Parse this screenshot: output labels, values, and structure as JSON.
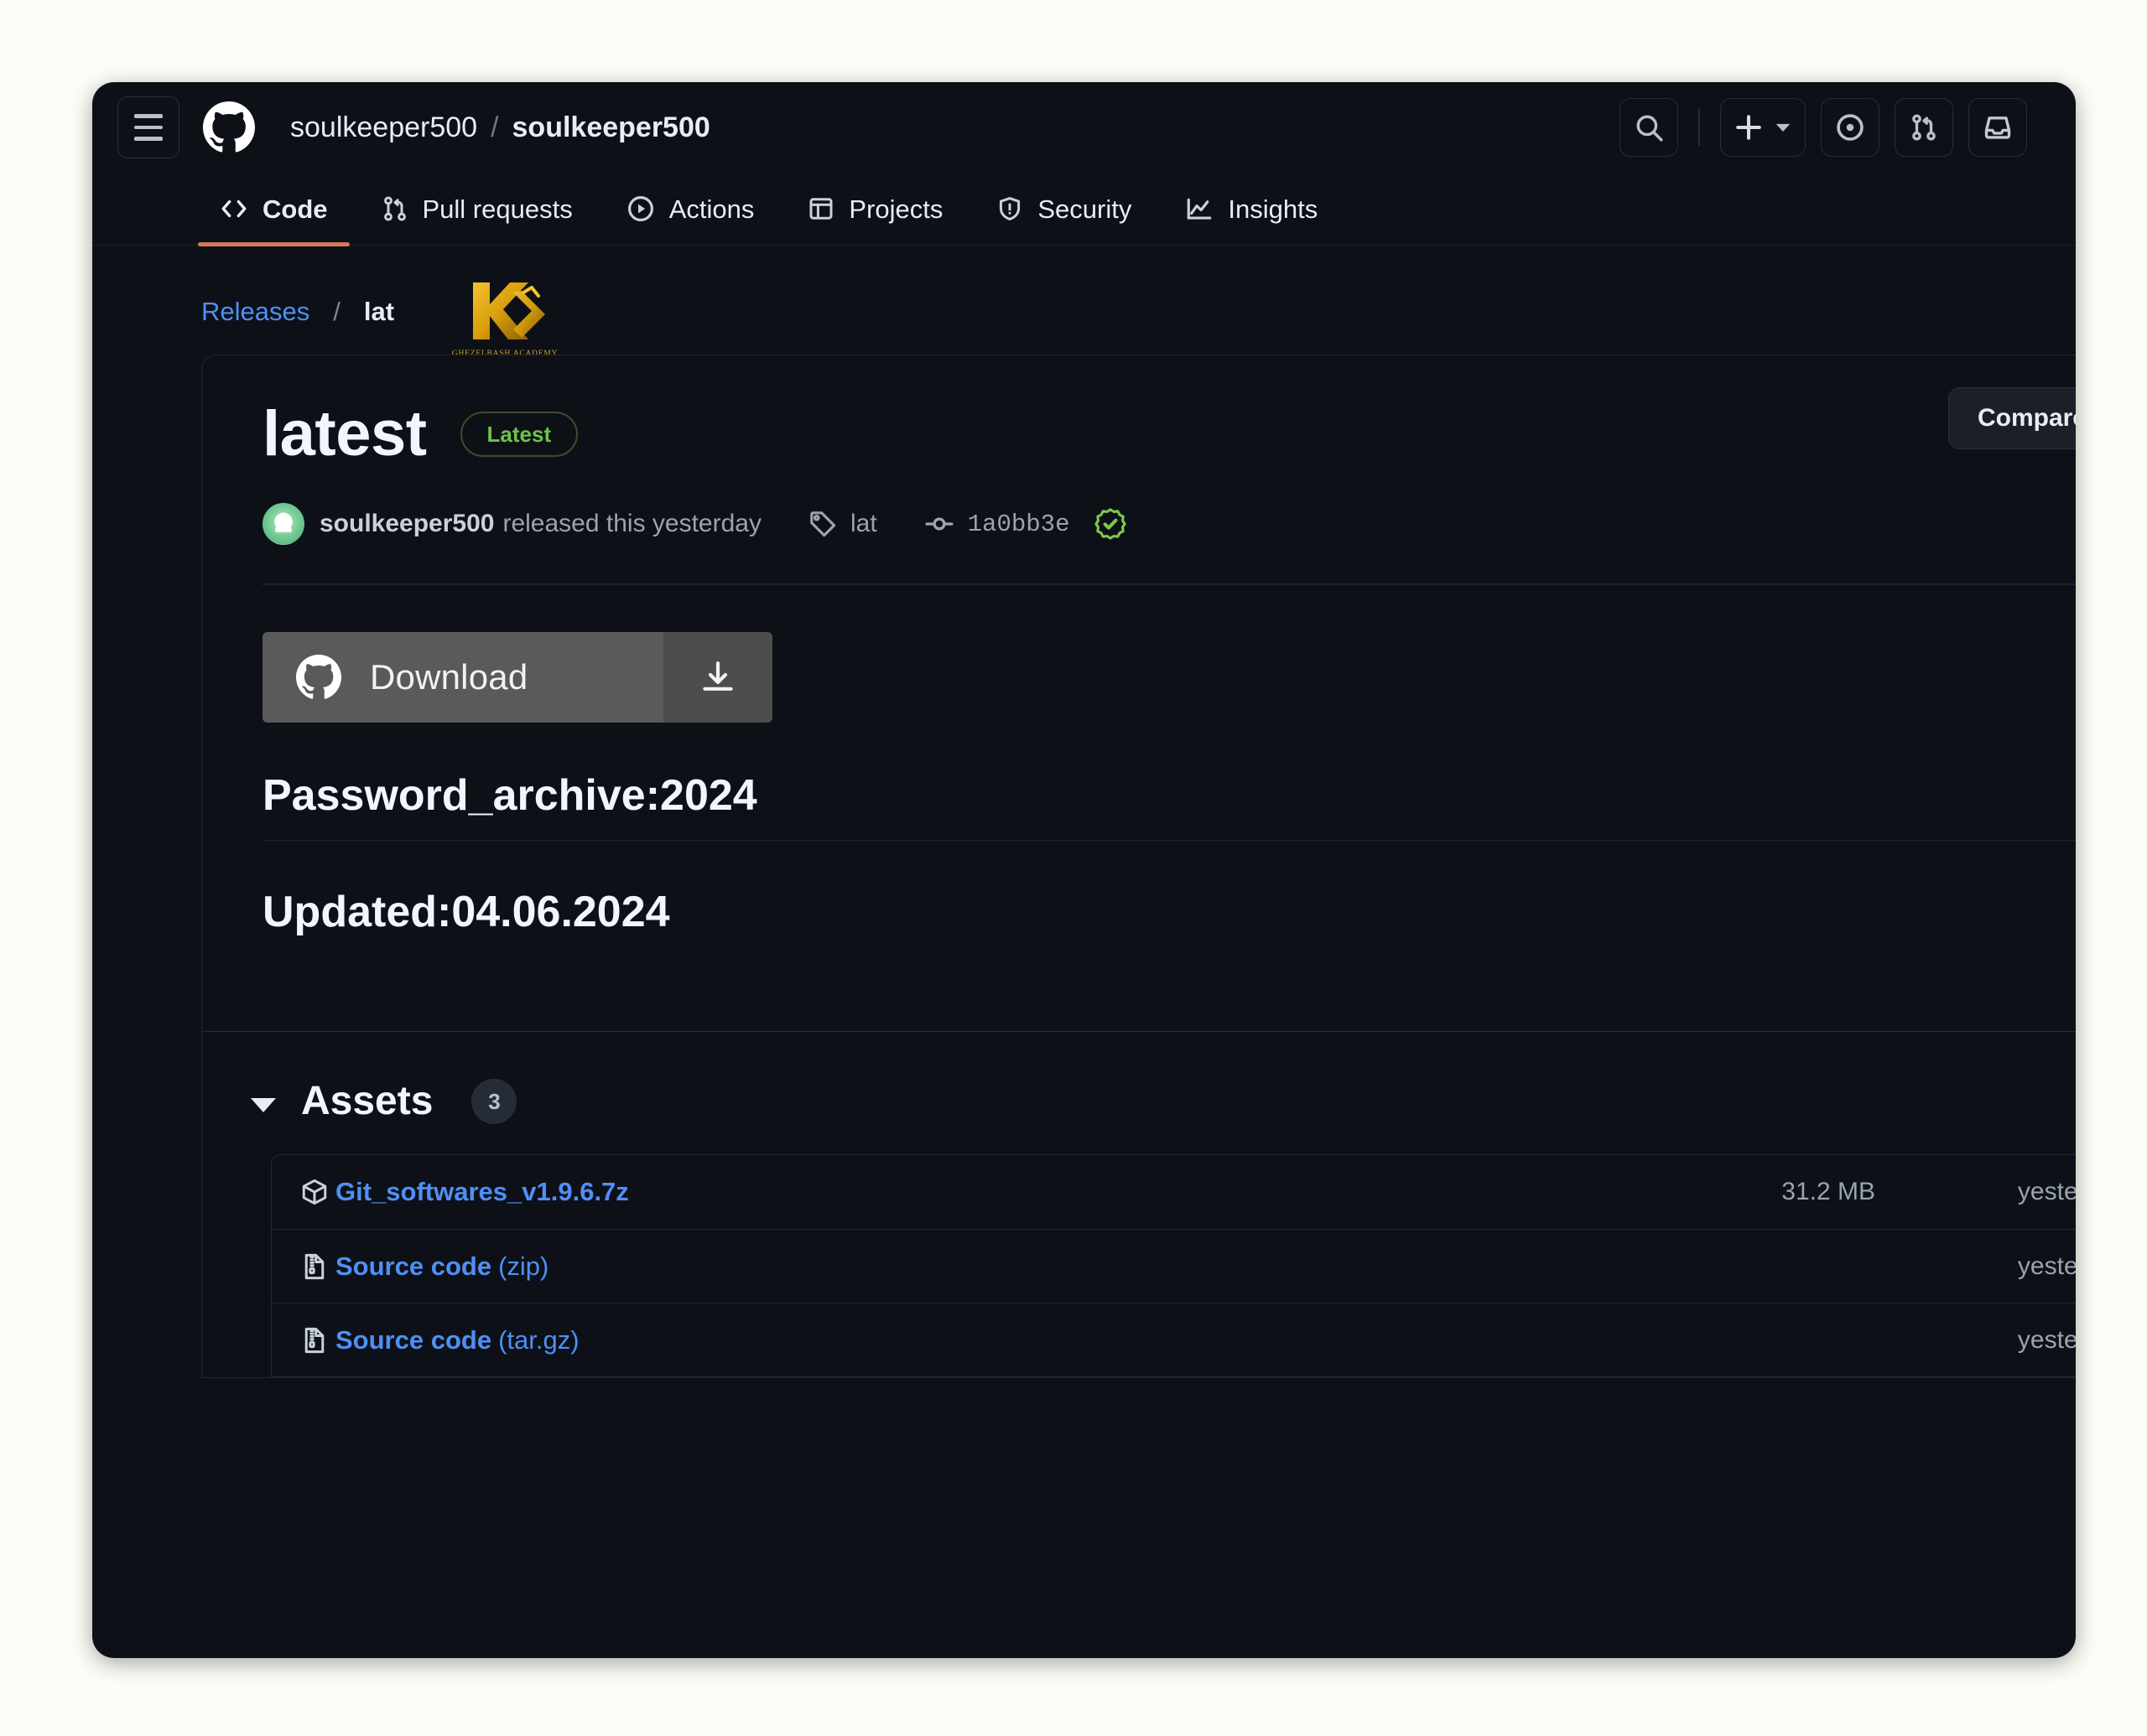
{
  "colors": {
    "page_background": "#fdfdf7",
    "window_background": "#0d1117",
    "accent_link": "#4f8ff7",
    "active_tab_underline": "#d2795c",
    "latest_badge": "#6fc14a",
    "logo_gold": "#e0a80d",
    "download_button": "#5a5a5a"
  },
  "header": {
    "menu_icon": "hamburger-menu-icon",
    "logo_icon": "github-logo-icon",
    "breadcrumb": {
      "owner": "soulkeeper500",
      "separator": "/",
      "repo": "soulkeeper500"
    },
    "actions": [
      {
        "name": "search",
        "icon": "search-icon"
      },
      {
        "name": "create-new",
        "icon": "plus-icon",
        "caret": "chevron-down-icon"
      },
      {
        "name": "issues",
        "icon": "issue-opened-icon"
      },
      {
        "name": "pull-requests",
        "icon": "git-pull-request-icon"
      },
      {
        "name": "notifications",
        "icon": "inbox-icon"
      }
    ]
  },
  "nav": {
    "tabs": [
      {
        "label": "Code",
        "icon": "code-icon",
        "active": true
      },
      {
        "label": "Pull requests",
        "icon": "git-pull-request-icon",
        "active": false
      },
      {
        "label": "Actions",
        "icon": "play-circle-icon",
        "active": false
      },
      {
        "label": "Projects",
        "icon": "table-icon",
        "active": false
      },
      {
        "label": "Security",
        "icon": "shield-icon",
        "active": false
      },
      {
        "label": "Insights",
        "icon": "graph-icon",
        "active": false
      }
    ]
  },
  "breadcrumb": {
    "releases_link": "Releases",
    "separator": "/",
    "current": "lat"
  },
  "brand_logo": {
    "mark": "K",
    "caption": "GHEZELBASH  ACADEMY"
  },
  "release": {
    "title": "latest",
    "badge": "Latest",
    "compare_button": "Compare",
    "compare_caret": "chevron-down-icon",
    "author": "soulkeeper500",
    "released_text": "released this yesterday",
    "tag_icon": "tag-icon",
    "tag": "lat",
    "commit_icon": "commit-icon",
    "commit": "1a0bb3e",
    "verified_icon": "verified-check-icon",
    "download_button": {
      "label": "Download",
      "logo_icon": "github-logo-icon",
      "action_icon": "download-icon"
    },
    "body": {
      "heading_1": "Password_archive:2024",
      "heading_2": "Updated:04.06.2024"
    }
  },
  "assets": {
    "title": "Assets",
    "count": "3",
    "caret_icon": "triangle-down-icon",
    "items": [
      {
        "name": "Git_softwares_v1.9.6.7z",
        "suffix": "",
        "icon": "package-icon",
        "size": "31.2 MB",
        "date": "yesterday"
      },
      {
        "name": "Source code",
        "suffix": " (zip)",
        "icon": "file-zip-icon",
        "size": "",
        "date": "yesterday"
      },
      {
        "name": "Source code",
        "suffix": " (tar.gz)",
        "icon": "file-zip-icon",
        "size": "",
        "date": "yesterday"
      }
    ]
  }
}
